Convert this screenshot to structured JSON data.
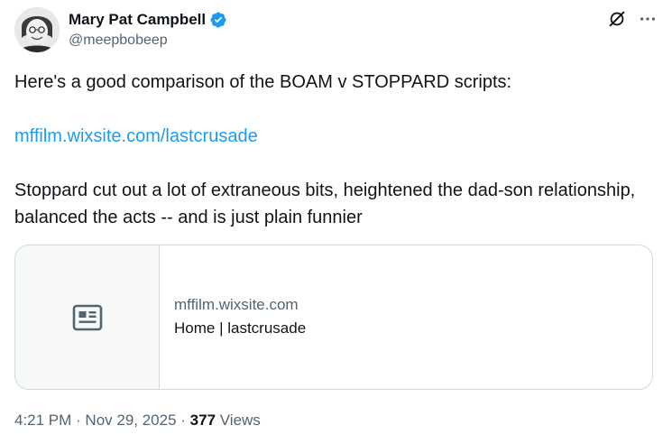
{
  "author": {
    "display_name": "Mary Pat Campbell",
    "handle": "@meepbobeep",
    "verified_color": "#1d9bf0"
  },
  "icons": {
    "avatar": "profile-photo",
    "verified": "verified-badge-icon",
    "grok": "grok-icon",
    "more": "more-icon",
    "card_thumb": "article-icon"
  },
  "tweet": {
    "line1": "Here's a good comparison of the BOAM v STOPPARD scripts:",
    "link": "mffilm.wixsite.com/lastcrusade",
    "line3": "Stoppard cut out a lot of extraneous bits, heightened the dad-son relationship, balanced the acts -- and is just plain funnier"
  },
  "card": {
    "domain": "mffilm.wixsite.com",
    "title": "Home | lastcrusade"
  },
  "meta": {
    "time": "4:21 PM",
    "separator1": " · ",
    "date": "Nov 29, 2025",
    "separator2": " · ",
    "views_count": "377",
    "views_label": " Views"
  },
  "colors": {
    "text": "#0f1419",
    "secondary": "#536471",
    "link": "#1d9bf0",
    "border": "#cfd9de"
  }
}
